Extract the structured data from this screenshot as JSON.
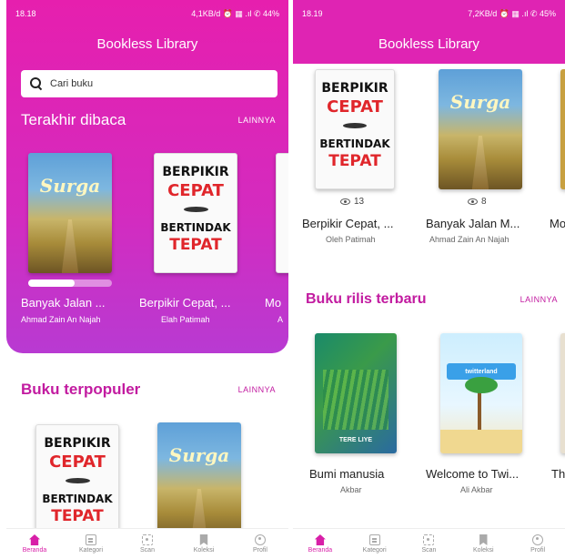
{
  "app": {
    "title": "Bookless Library"
  },
  "screen1": {
    "status": {
      "time": "18.18",
      "right": "4,1KB/d ⏰ ▦ .ıl ✆ 44%"
    },
    "search": {
      "placeholder": "Cari buku"
    },
    "recent": {
      "title": "Terakhir dibaca",
      "more": "LAINNYA",
      "books": [
        {
          "title": "Banyak Jalan ...",
          "author": "Ahmad Zain An Najah",
          "progress": 0.55
        },
        {
          "title": "Berpikir Cepat, ...",
          "author": "Elah Patimah",
          "progress": 0
        },
        {
          "title": "Mo",
          "author": "A"
        }
      ]
    },
    "popular": {
      "title": "Buku terpopuler",
      "more": "LAINNYA"
    }
  },
  "screen2": {
    "status": {
      "time": "18.19",
      "right": "7,2KB/d ⏰ ▦ .ıl ✆ 45%"
    },
    "popular_books": [
      {
        "title": "Berpikir Cepat, ...",
        "author": "Oleh Patimah",
        "views": "13"
      },
      {
        "title": "Banyak Jalan M...",
        "author": "Ahmad Zain An Najah",
        "views": "8"
      },
      {
        "title": "Mo"
      }
    ],
    "new_release": {
      "title": "Buku rilis terbaru",
      "more": "LAINNYA",
      "books": [
        {
          "title": "Bumi manusia",
          "author": "Akbar"
        },
        {
          "title": "Welcome to Twi...",
          "author": "Ali Akbar"
        },
        {
          "title": "Th"
        }
      ]
    }
  },
  "covers": {
    "berpikir_line1": "BERPIKIR",
    "berpikir_line2": "CEPAT",
    "berpikir_line3": "BERTINDAK",
    "berpikir_line4": "TEPAT",
    "jalan_script": "Surga",
    "bumi_caption": "TERE LIYE",
    "twi_banner": "twitterland"
  },
  "nav": {
    "items": [
      {
        "label": "Beranda",
        "icon": "home-icon"
      },
      {
        "label": "Kategori",
        "icon": "category-icon"
      },
      {
        "label": "Scan",
        "icon": "scan-icon"
      },
      {
        "label": "Koleksi",
        "icon": "bookmark-icon"
      },
      {
        "label": "Profil",
        "icon": "profile-icon"
      }
    ]
  },
  "colors": {
    "primary": "#e61fae",
    "accent": "#d81fa8",
    "heading": "#c21ba0"
  }
}
